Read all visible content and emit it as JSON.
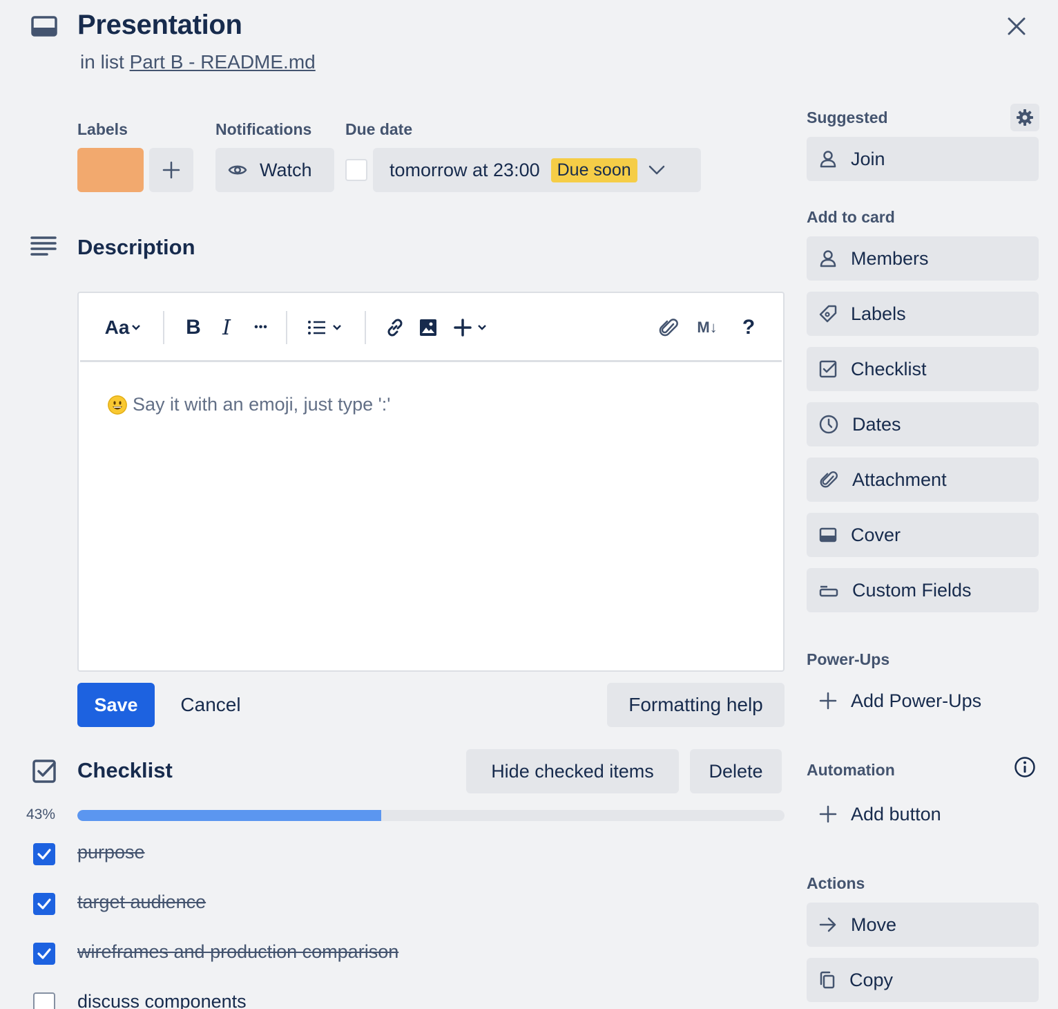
{
  "card": {
    "title": "Presentation",
    "in_list_prefix": "in list",
    "list_name": "Part B - README.md"
  },
  "fields": {
    "labels_heading": "Labels",
    "label_color": "#f2a96e",
    "notifications_heading": "Notifications",
    "watch_label": "Watch",
    "due_heading": "Due date",
    "due_value": "tomorrow at 23:00",
    "due_badge": "Due soon"
  },
  "description": {
    "heading": "Description",
    "placeholder": "Say it with an emoji, just type ':'",
    "toolbar": {
      "text_style": "Aa",
      "bold": "B",
      "italic": "I",
      "more": "•••",
      "markdown": "M↓",
      "help": "?"
    },
    "save_label": "Save",
    "cancel_label": "Cancel",
    "formatting_help_label": "Formatting help"
  },
  "checklist": {
    "heading": "Checklist",
    "hide_checked_label": "Hide checked items",
    "delete_label": "Delete",
    "progress_percent": 43,
    "progress_text": "43%",
    "items": [
      {
        "text": "purpose",
        "checked": true
      },
      {
        "text": "target audience",
        "checked": true
      },
      {
        "text": "wireframes and production comparison",
        "checked": true
      },
      {
        "text": "discuss components",
        "checked": false
      }
    ]
  },
  "sidebar": {
    "suggested_heading": "Suggested",
    "join_label": "Join",
    "add_to_card_heading": "Add to card",
    "add_to_card": [
      {
        "label": "Members",
        "icon": "person-icon"
      },
      {
        "label": "Labels",
        "icon": "tag-icon"
      },
      {
        "label": "Checklist",
        "icon": "checkbox-icon"
      },
      {
        "label": "Dates",
        "icon": "clock-icon"
      },
      {
        "label": "Attachment",
        "icon": "paperclip-icon"
      },
      {
        "label": "Cover",
        "icon": "cover-icon"
      },
      {
        "label": "Custom Fields",
        "icon": "custom-fields-icon"
      }
    ],
    "powerups_heading": "Power-Ups",
    "add_powerups_label": "Add Power-Ups",
    "automation_heading": "Automation",
    "add_button_label": "Add button",
    "actions_heading": "Actions",
    "move_label": "Move",
    "copy_label": "Copy"
  },
  "colors": {
    "primary": "#1d62e0",
    "progress_fill": "#5b96f0",
    "badge_yellow": "#f5cd47",
    "background": "#f1f2f4"
  }
}
